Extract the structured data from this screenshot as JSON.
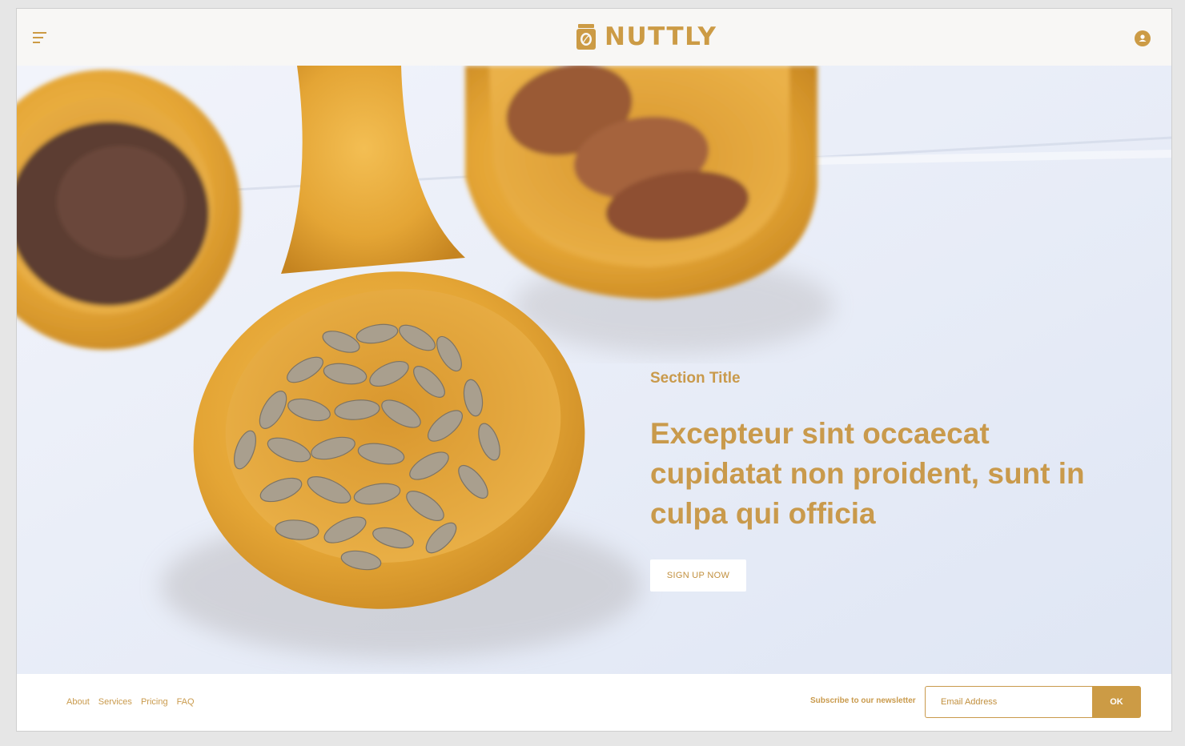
{
  "header": {
    "brand_name": "NUTTLY",
    "menu_icon": "hamburger-menu-icon",
    "logo_icon": "nut-jar-logo-icon",
    "user_icon": "user-avatar-icon"
  },
  "hero": {
    "image": "wooden spoons with seeds and almonds",
    "section_title": "Section Title",
    "headline": "Excepteur sint occaecat cupidatat non proident, sunt in culpa qui officia",
    "cta_label": "SIGN UP NOW"
  },
  "footer": {
    "nav": [
      "About",
      "Services",
      "Pricing",
      "FAQ"
    ],
    "newsletter_label": "Subscribe to our newsletter",
    "email_placeholder": "Email Address",
    "submit_label": "OK"
  },
  "colors": {
    "accent": "#cc9b45",
    "header_bg": "#f8f7f5",
    "page_bg": "#e6e6e6"
  }
}
